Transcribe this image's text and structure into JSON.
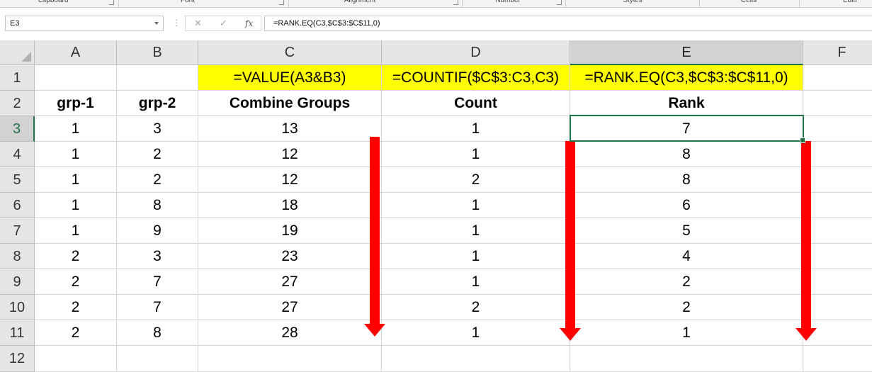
{
  "ribbon": {
    "groups": [
      {
        "label": "Clipboard"
      },
      {
        "label": "Font"
      },
      {
        "label": "Alignment"
      },
      {
        "label": "Number"
      },
      {
        "label": "Styles"
      },
      {
        "label": "Cells"
      },
      {
        "label": "Editi"
      }
    ]
  },
  "formula_bar": {
    "name_box": "E3",
    "fx_label": "fx",
    "formula": "=RANK.EQ(C3,$C$3:$C$11,0)"
  },
  "sheet": {
    "columns": [
      "A",
      "B",
      "C",
      "D",
      "E",
      "F"
    ],
    "selected_column": "E",
    "rows": [
      "1",
      "2",
      "3",
      "4",
      "5",
      "6",
      "7",
      "8",
      "9",
      "10",
      "11",
      "12"
    ],
    "selected_row": "3",
    "selected_cell": "E3",
    "formula_notes": {
      "C1": "=VALUE(A3&B3)",
      "D1": "=COUNTIF($C$3:C3,C3)",
      "E1": "=RANK.EQ(C3,$C$3:$C$11,0)"
    },
    "headers": {
      "A2": "grp-1",
      "B2": "grp-2",
      "C2": "Combine Groups",
      "D2": "Count",
      "E2": "Rank"
    },
    "data_rows": [
      [
        "1",
        "3",
        "13",
        "1",
        "7"
      ],
      [
        "1",
        "2",
        "12",
        "1",
        "8"
      ],
      [
        "1",
        "2",
        "12",
        "2",
        "8"
      ],
      [
        "1",
        "8",
        "18",
        "1",
        "6"
      ],
      [
        "1",
        "9",
        "19",
        "1",
        "5"
      ],
      [
        "2",
        "3",
        "23",
        "1",
        "4"
      ],
      [
        "2",
        "7",
        "27",
        "1",
        "2"
      ],
      [
        "2",
        "7",
        "27",
        "2",
        "2"
      ],
      [
        "2",
        "8",
        "28",
        "1",
        "1"
      ]
    ]
  },
  "colors": {
    "highlight_fill": "#ffff00",
    "arrow": "#ff0000",
    "selection": "#217346"
  }
}
